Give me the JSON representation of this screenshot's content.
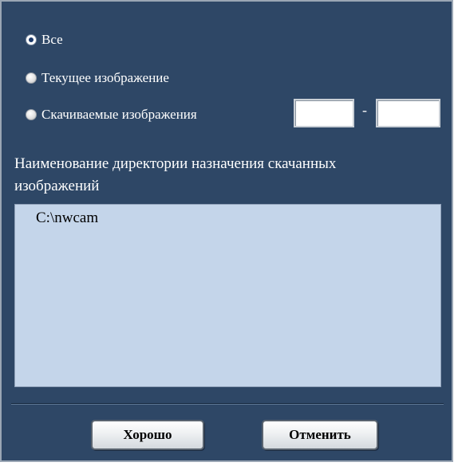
{
  "options": {
    "all_label": "Все",
    "current_label": "Текущее изображение",
    "downloaded_label": "Скачиваемые изображения",
    "range_from": "",
    "range_to": "",
    "range_separator": "-",
    "selected": "all"
  },
  "destination": {
    "label": "Наименование директории назначения скачанных изображений",
    "path": "C:\\nwcam"
  },
  "buttons": {
    "ok_label": "Хорошо",
    "cancel_label": "Отменить"
  }
}
